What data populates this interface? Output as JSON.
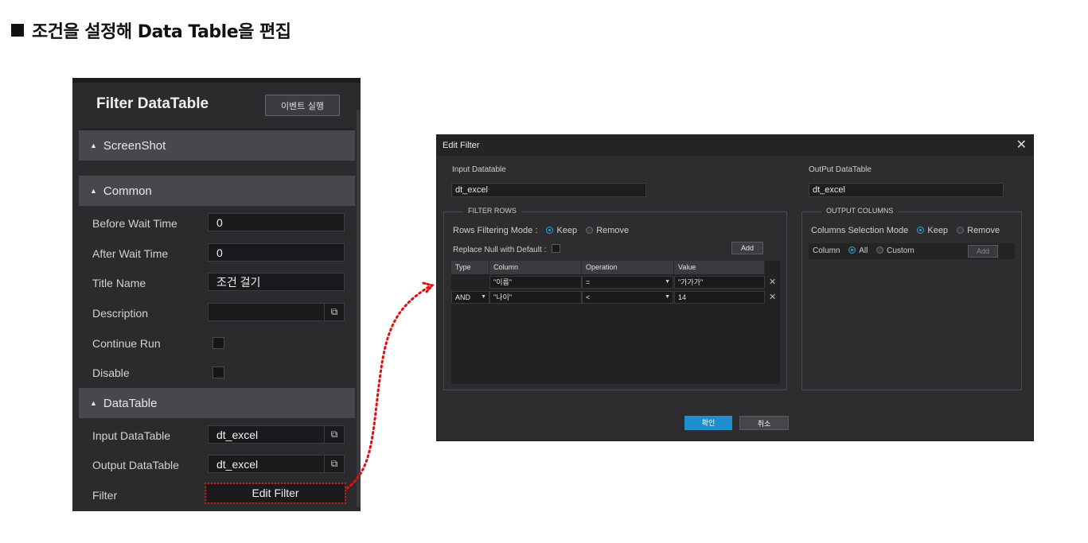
{
  "heading": "조건을 설정해 Data Table을 편집",
  "panel": {
    "title": "Filter DataTable",
    "event_button": "이벤트 실행",
    "sections": {
      "screenshot": "ScreenShot",
      "common": "Common",
      "datatable": "DataTable"
    },
    "fields": {
      "before_wait_label": "Before Wait Time",
      "before_wait_value": "0",
      "after_wait_label": "After Wait Time",
      "after_wait_value": "0",
      "title_name_label": "Title Name",
      "title_name_value": "조건 걸기",
      "description_label": "Description",
      "description_value": "",
      "continue_run_label": "Continue Run",
      "disable_label": "Disable",
      "input_dt_label": "Input DataTable",
      "input_dt_value": "dt_excel",
      "output_dt_label": "Output DataTable",
      "output_dt_value": "dt_excel",
      "filter_label": "Filter",
      "filter_button": "Edit Filter"
    }
  },
  "dialog": {
    "title": "Edit Filter",
    "input_label": "Input Datatable",
    "input_value": "dt_excel",
    "output_label": "OutPut DataTable",
    "output_value": "dt_excel",
    "filter_rows": {
      "legend": "FILTER ROWS",
      "mode_label": "Rows Filtering Mode :",
      "keep": "Keep",
      "remove": "Remove",
      "replace_null": "Replace Null with Default :",
      "add": "Add",
      "columns": [
        "Type",
        "Column",
        "Operation",
        "Value"
      ],
      "rows": [
        {
          "type": "",
          "column": "\"이름\"",
          "operation": "=",
          "value": "\"가가가\""
        },
        {
          "type": "AND",
          "column": "\"나이\"",
          "operation": "<",
          "value": "14"
        }
      ]
    },
    "output_columns": {
      "legend": "OUTPUT COLUMNS",
      "mode_label": "Columns Selection Mode",
      "keep": "Keep",
      "remove": "Remove",
      "column_label": "Column",
      "all": "All",
      "custom": "Custom",
      "add": "Add"
    },
    "ok": "확인",
    "cancel": "취소"
  },
  "colors": {
    "accent": "#2ea2d6",
    "ok_button": "#1e8fcf",
    "highlight": "#dd1111"
  }
}
